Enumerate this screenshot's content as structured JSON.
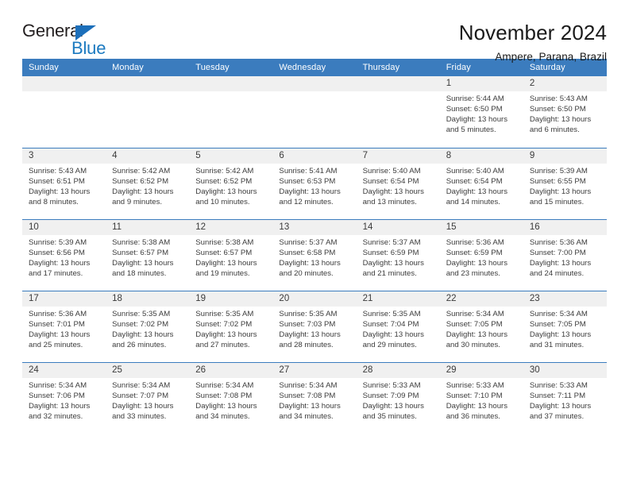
{
  "logo": {
    "word_top": "General",
    "word_bottom": "Blue",
    "triangle_color": "#1c6fba",
    "bottom_color": "#1c7ac0"
  },
  "header": {
    "title": "November 2024",
    "subtitle": "Ampere, Parana, Brazil"
  },
  "theme": {
    "header_blue": "#3b7cbe",
    "daynum_bg": "#f0f0f0",
    "text": "#3c3c3c"
  },
  "calendar": {
    "weekday_headers": [
      "Sunday",
      "Monday",
      "Tuesday",
      "Wednesday",
      "Thursday",
      "Friday",
      "Saturday"
    ],
    "labels": {
      "sunrise": "Sunrise:",
      "sunset": "Sunset:",
      "daylight": "Daylight:"
    },
    "weeks": [
      [
        {
          "day": "",
          "blank": true
        },
        {
          "day": "",
          "blank": true
        },
        {
          "day": "",
          "blank": true
        },
        {
          "day": "",
          "blank": true
        },
        {
          "day": "",
          "blank": true
        },
        {
          "day": "1",
          "sunrise": "Sunrise: 5:44 AM",
          "sunset": "Sunset: 6:50 PM",
          "daylight_1": "Daylight: 13 hours",
          "daylight_2": "and 5 minutes."
        },
        {
          "day": "2",
          "sunrise": "Sunrise: 5:43 AM",
          "sunset": "Sunset: 6:50 PM",
          "daylight_1": "Daylight: 13 hours",
          "daylight_2": "and 6 minutes."
        }
      ],
      [
        {
          "day": "3",
          "sunrise": "Sunrise: 5:43 AM",
          "sunset": "Sunset: 6:51 PM",
          "daylight_1": "Daylight: 13 hours",
          "daylight_2": "and 8 minutes."
        },
        {
          "day": "4",
          "sunrise": "Sunrise: 5:42 AM",
          "sunset": "Sunset: 6:52 PM",
          "daylight_1": "Daylight: 13 hours",
          "daylight_2": "and 9 minutes."
        },
        {
          "day": "5",
          "sunrise": "Sunrise: 5:42 AM",
          "sunset": "Sunset: 6:52 PM",
          "daylight_1": "Daylight: 13 hours",
          "daylight_2": "and 10 minutes."
        },
        {
          "day": "6",
          "sunrise": "Sunrise: 5:41 AM",
          "sunset": "Sunset: 6:53 PM",
          "daylight_1": "Daylight: 13 hours",
          "daylight_2": "and 12 minutes."
        },
        {
          "day": "7",
          "sunrise": "Sunrise: 5:40 AM",
          "sunset": "Sunset: 6:54 PM",
          "daylight_1": "Daylight: 13 hours",
          "daylight_2": "and 13 minutes."
        },
        {
          "day": "8",
          "sunrise": "Sunrise: 5:40 AM",
          "sunset": "Sunset: 6:54 PM",
          "daylight_1": "Daylight: 13 hours",
          "daylight_2": "and 14 minutes."
        },
        {
          "day": "9",
          "sunrise": "Sunrise: 5:39 AM",
          "sunset": "Sunset: 6:55 PM",
          "daylight_1": "Daylight: 13 hours",
          "daylight_2": "and 15 minutes."
        }
      ],
      [
        {
          "day": "10",
          "sunrise": "Sunrise: 5:39 AM",
          "sunset": "Sunset: 6:56 PM",
          "daylight_1": "Daylight: 13 hours",
          "daylight_2": "and 17 minutes."
        },
        {
          "day": "11",
          "sunrise": "Sunrise: 5:38 AM",
          "sunset": "Sunset: 6:57 PM",
          "daylight_1": "Daylight: 13 hours",
          "daylight_2": "and 18 minutes."
        },
        {
          "day": "12",
          "sunrise": "Sunrise: 5:38 AM",
          "sunset": "Sunset: 6:57 PM",
          "daylight_1": "Daylight: 13 hours",
          "daylight_2": "and 19 minutes."
        },
        {
          "day": "13",
          "sunrise": "Sunrise: 5:37 AM",
          "sunset": "Sunset: 6:58 PM",
          "daylight_1": "Daylight: 13 hours",
          "daylight_2": "and 20 minutes."
        },
        {
          "day": "14",
          "sunrise": "Sunrise: 5:37 AM",
          "sunset": "Sunset: 6:59 PM",
          "daylight_1": "Daylight: 13 hours",
          "daylight_2": "and 21 minutes."
        },
        {
          "day": "15",
          "sunrise": "Sunrise: 5:36 AM",
          "sunset": "Sunset: 6:59 PM",
          "daylight_1": "Daylight: 13 hours",
          "daylight_2": "and 23 minutes."
        },
        {
          "day": "16",
          "sunrise": "Sunrise: 5:36 AM",
          "sunset": "Sunset: 7:00 PM",
          "daylight_1": "Daylight: 13 hours",
          "daylight_2": "and 24 minutes."
        }
      ],
      [
        {
          "day": "17",
          "sunrise": "Sunrise: 5:36 AM",
          "sunset": "Sunset: 7:01 PM",
          "daylight_1": "Daylight: 13 hours",
          "daylight_2": "and 25 minutes."
        },
        {
          "day": "18",
          "sunrise": "Sunrise: 5:35 AM",
          "sunset": "Sunset: 7:02 PM",
          "daylight_1": "Daylight: 13 hours",
          "daylight_2": "and 26 minutes."
        },
        {
          "day": "19",
          "sunrise": "Sunrise: 5:35 AM",
          "sunset": "Sunset: 7:02 PM",
          "daylight_1": "Daylight: 13 hours",
          "daylight_2": "and 27 minutes."
        },
        {
          "day": "20",
          "sunrise": "Sunrise: 5:35 AM",
          "sunset": "Sunset: 7:03 PM",
          "daylight_1": "Daylight: 13 hours",
          "daylight_2": "and 28 minutes."
        },
        {
          "day": "21",
          "sunrise": "Sunrise: 5:35 AM",
          "sunset": "Sunset: 7:04 PM",
          "daylight_1": "Daylight: 13 hours",
          "daylight_2": "and 29 minutes."
        },
        {
          "day": "22",
          "sunrise": "Sunrise: 5:34 AM",
          "sunset": "Sunset: 7:05 PM",
          "daylight_1": "Daylight: 13 hours",
          "daylight_2": "and 30 minutes."
        },
        {
          "day": "23",
          "sunrise": "Sunrise: 5:34 AM",
          "sunset": "Sunset: 7:05 PM",
          "daylight_1": "Daylight: 13 hours",
          "daylight_2": "and 31 minutes."
        }
      ],
      [
        {
          "day": "24",
          "sunrise": "Sunrise: 5:34 AM",
          "sunset": "Sunset: 7:06 PM",
          "daylight_1": "Daylight: 13 hours",
          "daylight_2": "and 32 minutes."
        },
        {
          "day": "25",
          "sunrise": "Sunrise: 5:34 AM",
          "sunset": "Sunset: 7:07 PM",
          "daylight_1": "Daylight: 13 hours",
          "daylight_2": "and 33 minutes."
        },
        {
          "day": "26",
          "sunrise": "Sunrise: 5:34 AM",
          "sunset": "Sunset: 7:08 PM",
          "daylight_1": "Daylight: 13 hours",
          "daylight_2": "and 34 minutes."
        },
        {
          "day": "27",
          "sunrise": "Sunrise: 5:34 AM",
          "sunset": "Sunset: 7:08 PM",
          "daylight_1": "Daylight: 13 hours",
          "daylight_2": "and 34 minutes."
        },
        {
          "day": "28",
          "sunrise": "Sunrise: 5:33 AM",
          "sunset": "Sunset: 7:09 PM",
          "daylight_1": "Daylight: 13 hours",
          "daylight_2": "and 35 minutes."
        },
        {
          "day": "29",
          "sunrise": "Sunrise: 5:33 AM",
          "sunset": "Sunset: 7:10 PM",
          "daylight_1": "Daylight: 13 hours",
          "daylight_2": "and 36 minutes."
        },
        {
          "day": "30",
          "sunrise": "Sunrise: 5:33 AM",
          "sunset": "Sunset: 7:11 PM",
          "daylight_1": "Daylight: 13 hours",
          "daylight_2": "and 37 minutes."
        }
      ]
    ]
  }
}
